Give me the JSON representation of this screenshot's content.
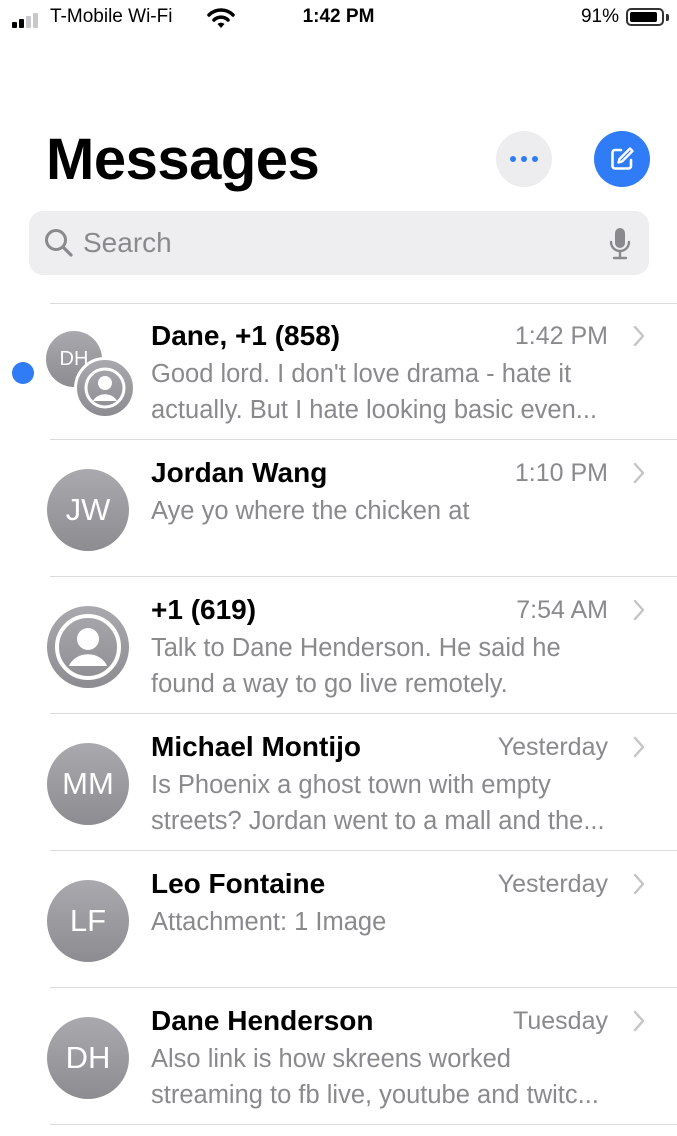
{
  "status_bar": {
    "carrier": "T-Mobile Wi-Fi",
    "time": "1:42 PM",
    "battery_percent": "91%",
    "battery_level": 0.91,
    "signal_bars": 2
  },
  "header": {
    "title": "Messages"
  },
  "search": {
    "placeholder": "Search"
  },
  "colors": {
    "accent": "#2f7cf6",
    "secondary_text": "#8a8a8e"
  },
  "conversations": [
    {
      "name": "Dane, +1 (858)",
      "time": "1:42 PM",
      "avatar_initials": "DH",
      "avatar_type": "group",
      "unread": true,
      "preview_line1": "Good lord. I don't love drama - hate it",
      "preview_line2": "actually. But I hate looking basic even..."
    },
    {
      "name": "Jordan Wang",
      "time": "1:10 PM",
      "avatar_initials": "JW",
      "avatar_type": "initials",
      "unread": false,
      "preview_line1": "Aye yo where the chicken at",
      "preview_line2": ""
    },
    {
      "name": "+1 (619)",
      "time": "7:54 AM",
      "avatar_initials": "",
      "avatar_type": "person",
      "unread": false,
      "preview_line1": "Talk to Dane Henderson. He said he",
      "preview_line2": "found a way to go live remotely."
    },
    {
      "name": "Michael Montijo",
      "time": "Yesterday",
      "avatar_initials": "MM",
      "avatar_type": "initials",
      "unread": false,
      "preview_line1": "Is Phoenix a ghost town with empty",
      "preview_line2": "streets? Jordan went to a mall and the..."
    },
    {
      "name": "Leo Fontaine",
      "time": "Yesterday",
      "avatar_initials": "LF",
      "avatar_type": "initials",
      "unread": false,
      "preview_line1": "Attachment: 1 Image",
      "preview_line2": ""
    },
    {
      "name": "Dane Henderson",
      "time": "Tuesday",
      "avatar_initials": "DH",
      "avatar_type": "initials",
      "unread": false,
      "preview_line1": "Also link is how skreens worked",
      "preview_line2": "streaming to fb live, youtube and twitc..."
    }
  ]
}
